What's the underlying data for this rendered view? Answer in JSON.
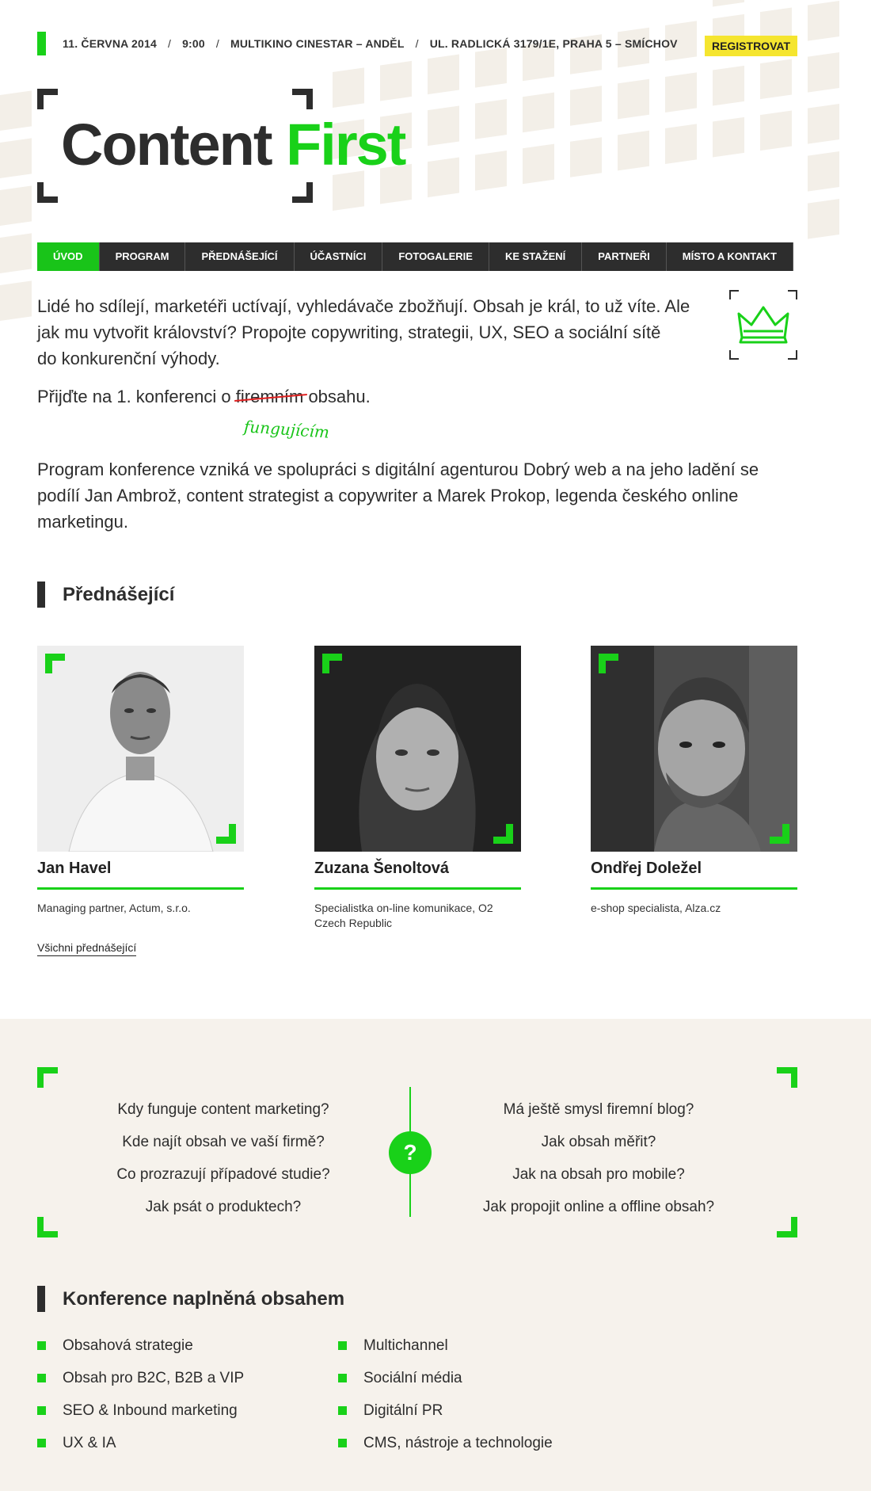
{
  "header": {
    "date": "11. ČERVNA 2014",
    "time": "9:00",
    "venue": "MULTIKINO CINESTAR – ANDĚL",
    "address": "UL. RADLICKÁ 3179/1E,  PRAHA 5 – SMÍCHOV",
    "separator": "/",
    "register_label": "REGISTROVAT"
  },
  "logo": {
    "part1": "Content",
    "part2": "First"
  },
  "nav": {
    "items": [
      {
        "label": "ÚVOD",
        "active": true
      },
      {
        "label": "PROGRAM"
      },
      {
        "label": "PŘEDNÁŠEJÍCÍ"
      },
      {
        "label": "ÚČASTNÍCI"
      },
      {
        "label": "FOTOGALERIE"
      },
      {
        "label": "KE STAŽENÍ"
      },
      {
        "label": "PARTNEŘI"
      },
      {
        "label": "MÍSTO A KONTAKT"
      }
    ]
  },
  "intro": {
    "para1_line1": "Lidé ho sdílejí, marketéři uctívají, vyhledávače zbožňují. Obsah je král, to už víte. Ale",
    "para1_line2": "jak mu vytvořit království? Propojte copywriting, strategii, UX, SEO a sociální sítě",
    "para1_line3": "do konkurenční výhody.",
    "para2_before": "Přijďte na 1. konferenci o ",
    "para2_struck": "firemním",
    "para2_after": " obsahu.",
    "handwritten": "fungujícím",
    "para3": "Program konference vzniká ve spolupráci s digitální agenturou Dobrý web a na jeho ladění se podílí Jan Ambrož, content strategist a copywriter a Marek Prokop, legenda českého online marketingu."
  },
  "speakers_section": {
    "title": "Přednášející",
    "speakers": [
      {
        "name": "Jan Havel",
        "role": "Managing partner, Actum, s.r.o."
      },
      {
        "name": "Zuzana Šenoltová",
        "role": "Specialistka on-line komunikace, O2 Czech Republic"
      },
      {
        "name": "Ondřej Doležel",
        "role": "e-shop specialista, Alza.cz"
      }
    ],
    "all_link": "Všichni přednášející"
  },
  "questions": {
    "left": [
      "Kdy funguje content marketing?",
      "Kde najít obsah ve vaší firmě?",
      "Co prozrazují případové studie?",
      "Jak psát o produktech?"
    ],
    "right": [
      "Má ještě smysl firemní blog?",
      "Jak obsah měřit?",
      "Jak na obsah pro mobile?",
      "Jak propojit online a offline obsah?"
    ],
    "center_symbol": "?"
  },
  "topics_section": {
    "title": "Konference naplněná obsahem",
    "left": [
      "Obsahová strategie",
      "Obsah pro B2C, B2B a VIP",
      "SEO & Inbound marketing",
      "UX & IA"
    ],
    "right": [
      "Multichannel",
      "Sociální média",
      "Digitální PR",
      "CMS, nástroje a technologie"
    ]
  },
  "colors": {
    "accent": "#19d119",
    "dark": "#2d2d2d",
    "highlight": "#f5e52f",
    "band": "#f6f2ec"
  }
}
